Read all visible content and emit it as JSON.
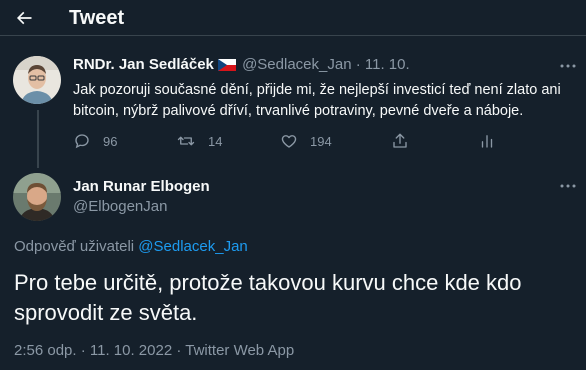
{
  "header": {
    "title": "Tweet",
    "back_icon": "arrow-left-icon"
  },
  "parent_tweet": {
    "author_name": "RNDr. Jan Sedláček",
    "handle": "@Sedlacek_Jan",
    "separator": "·",
    "date": "11. 10.",
    "text": "Jak pozoruji současné dění, přijde mi, že nejlepší investicí teď není zlato ani bitcoin, nýbrž palivové dříví, trvanlivé potraviny, pevné dveře a náboje.",
    "flag_icon": "czech-flag-icon",
    "actions": {
      "reply_count": "96",
      "retweet_count": "14",
      "like_count": "194"
    }
  },
  "main_tweet": {
    "author_name": "Jan Runar Elbogen",
    "handle": "@ElbogenJan",
    "reply_prefix": "Odpověď uživateli",
    "reply_to": "@Sedlacek_Jan",
    "text": "Pro tebe určitě, protože takovou kurvu chce kde kdo sprovodit ze světa.",
    "meta": "2:56 odp. · 11. 10. 2022 · Twitter Web App"
  },
  "colors": {
    "background": "#15202b",
    "text": "#f7f9f9",
    "muted": "#8b98a5",
    "accent": "#1d9bf0",
    "border": "#38444d"
  }
}
